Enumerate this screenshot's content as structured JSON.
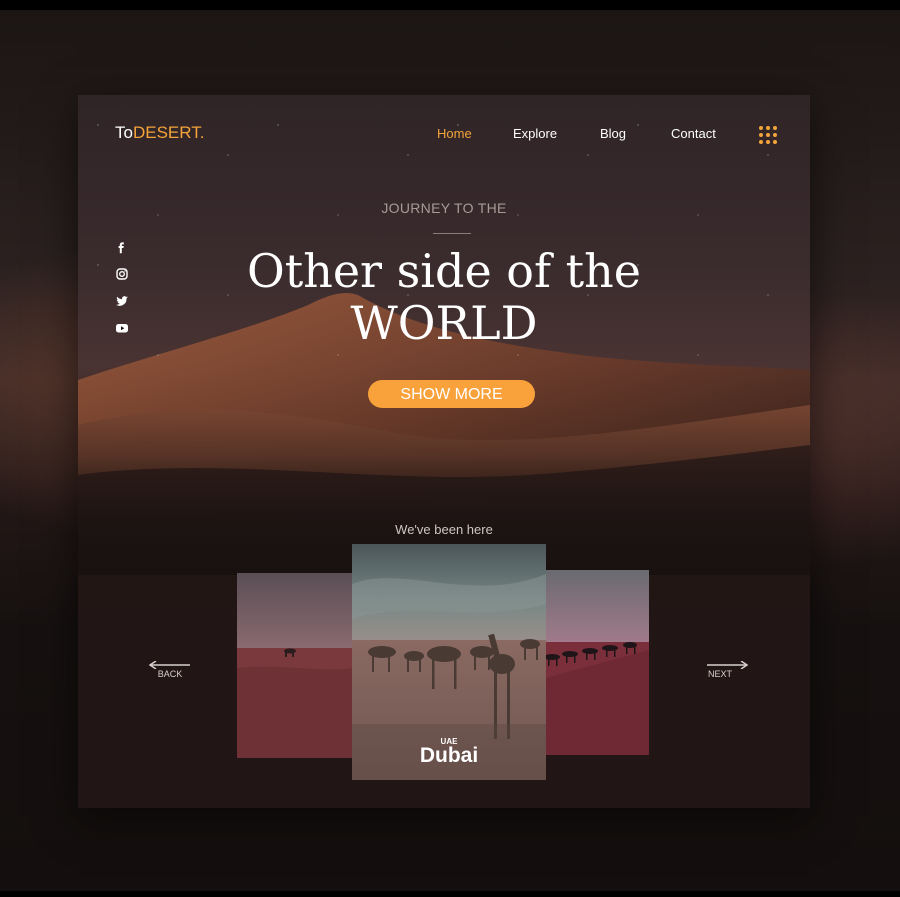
{
  "brand": {
    "prefix": "To",
    "accent": "DESERT."
  },
  "nav": {
    "home": "Home",
    "explore": "Explore",
    "blog": "Blog",
    "contact": "Contact"
  },
  "social": [
    "facebook-icon",
    "instagram-icon",
    "twitter-icon",
    "youtube-icon"
  ],
  "hero": {
    "kicker": "JOURNEY TO THE",
    "line1": "Other side of the",
    "line2": "WORLD",
    "cta": "SHOW MORE"
  },
  "places": {
    "heading": "We've been here",
    "back": "BACK",
    "next": "NEXT",
    "featured": {
      "country": "UAE",
      "city": "Dubai"
    }
  },
  "colors": {
    "accent": "#f5a43a",
    "button": "#f9a23b",
    "background": "#181110"
  }
}
